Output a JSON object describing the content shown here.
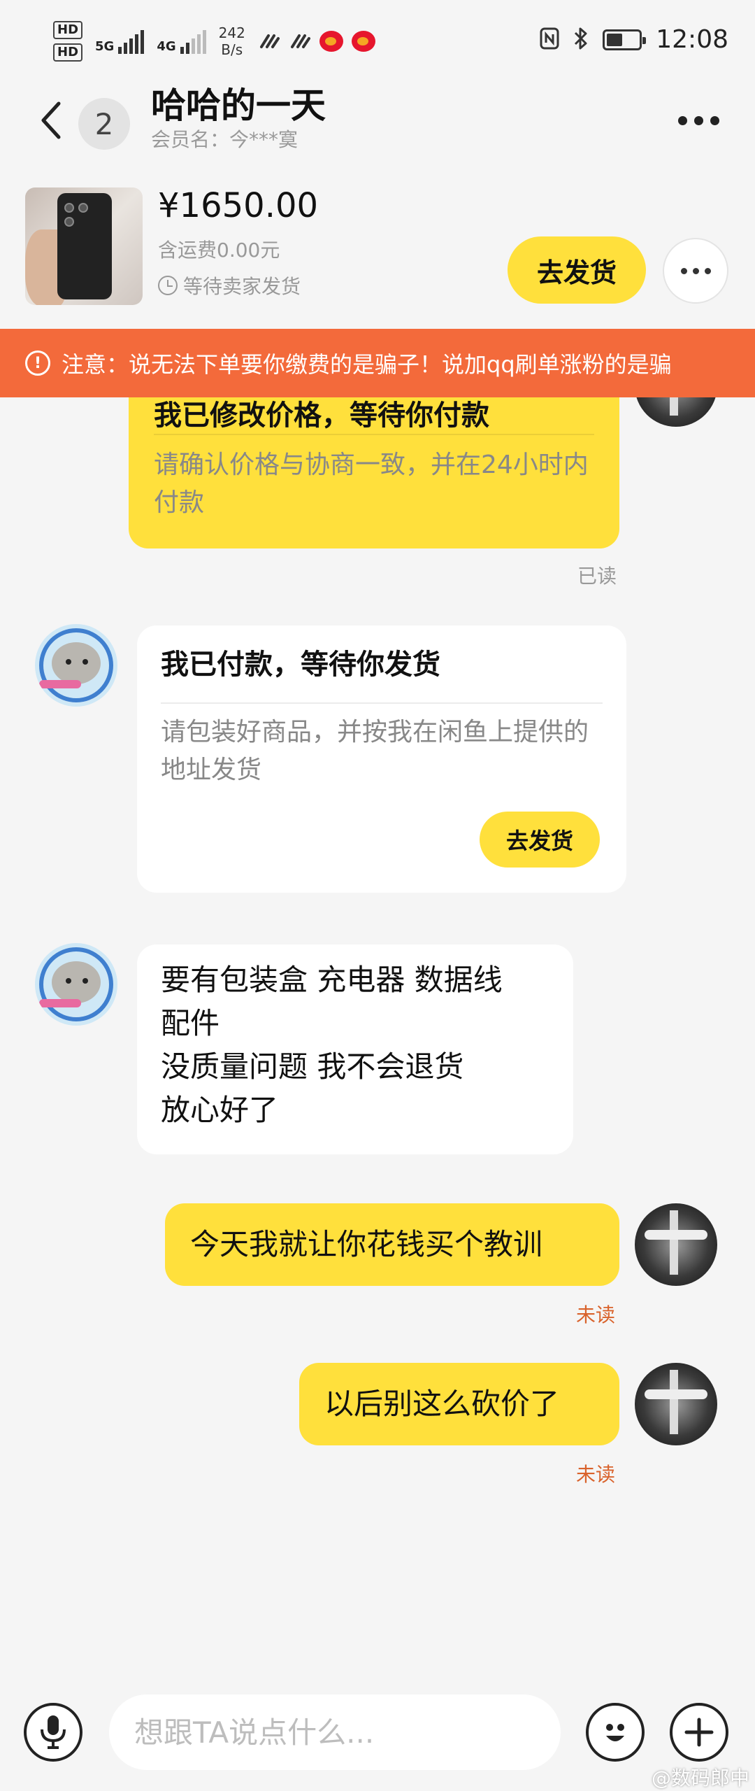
{
  "status_bar": {
    "hd1": "HD",
    "hd2": "HD",
    "net1": "5G",
    "net2": "4G",
    "speed_value": "242",
    "speed_unit": "B/s",
    "time": "12:08",
    "icons": [
      "nfc-icon",
      "bluetooth-icon",
      "battery-icon"
    ]
  },
  "header": {
    "back_icon": "chevron-left-icon",
    "unread_count": "2",
    "title": "哈哈的一天",
    "member_label": "会员名：今***寞"
  },
  "product": {
    "price": "¥1650.00",
    "freight": "含运费0.00元",
    "status": "等待卖家发货",
    "ship_button": "去发货"
  },
  "warning": {
    "text": "注意：说无法下单要你缴费的是骗子！说加qq刷单涨粉的是骗"
  },
  "messages": {
    "card1": {
      "title": "我已修改价格，等待你付款",
      "body": "请确认价格与协商一致，并在24小时内付款",
      "read": "已读"
    },
    "card2": {
      "title": "我已付款，等待你发货",
      "body": "请包装好商品，并按我在闲鱼上提供的地址发货",
      "button": "去发货"
    },
    "msg3": {
      "line1": "要有包装盒 充电器 数据线",
      "line2": "配件",
      "line3": "没质量问题 我不会退货",
      "line4": "放心好了"
    },
    "msg4": {
      "text": "今天我就让你花钱买个教训",
      "status": "未读"
    },
    "msg5": {
      "text": "以后别这么砍价了",
      "status": "未读"
    }
  },
  "input": {
    "placeholder": "想跟TA说点什么..."
  },
  "watermark": "@数码郎中",
  "colors": {
    "accent_yellow": "#ffe03c",
    "warning_orange": "#f36a3b",
    "unread_red": "#d9622b",
    "background": "#f5f5f5"
  }
}
